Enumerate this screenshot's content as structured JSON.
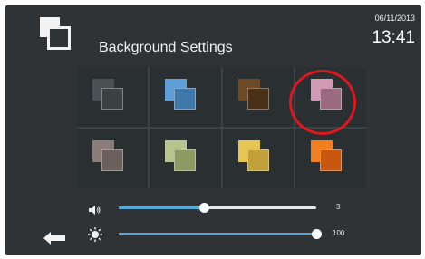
{
  "header": {
    "title": "Background Settings",
    "date": "06/11/2013",
    "time": "13:41"
  },
  "swatches": [
    {
      "name": "gray",
      "back": "#4a5053",
      "front": "#3b4043"
    },
    {
      "name": "blue",
      "back": "#5f9fd8",
      "front": "#3f78a8"
    },
    {
      "name": "brown",
      "back": "#6f4a26",
      "front": "#4a3016"
    },
    {
      "name": "pink",
      "back": "#d29ab4",
      "front": "#9a6a80",
      "selected": true
    },
    {
      "name": "taupe",
      "back": "#8a7c78",
      "front": "#6c605c"
    },
    {
      "name": "sage",
      "back": "#b8c48e",
      "front": "#8e9a64"
    },
    {
      "name": "gold",
      "back": "#e7c552",
      "front": "#c2a13a"
    },
    {
      "name": "orange",
      "back": "#f27f1e",
      "front": "#c9560f"
    }
  ],
  "sliders": {
    "volume": {
      "value": 3,
      "value_text": "3",
      "fraction": 0.43,
      "icon": "speaker-icon"
    },
    "brightness": {
      "value": 100,
      "value_text": "100",
      "fraction": 1.0,
      "icon": "sun-icon"
    }
  },
  "colors": {
    "slider_fill": "#59a7d9",
    "highlight": "#e0171f",
    "screen_bg": "#2f3336"
  }
}
